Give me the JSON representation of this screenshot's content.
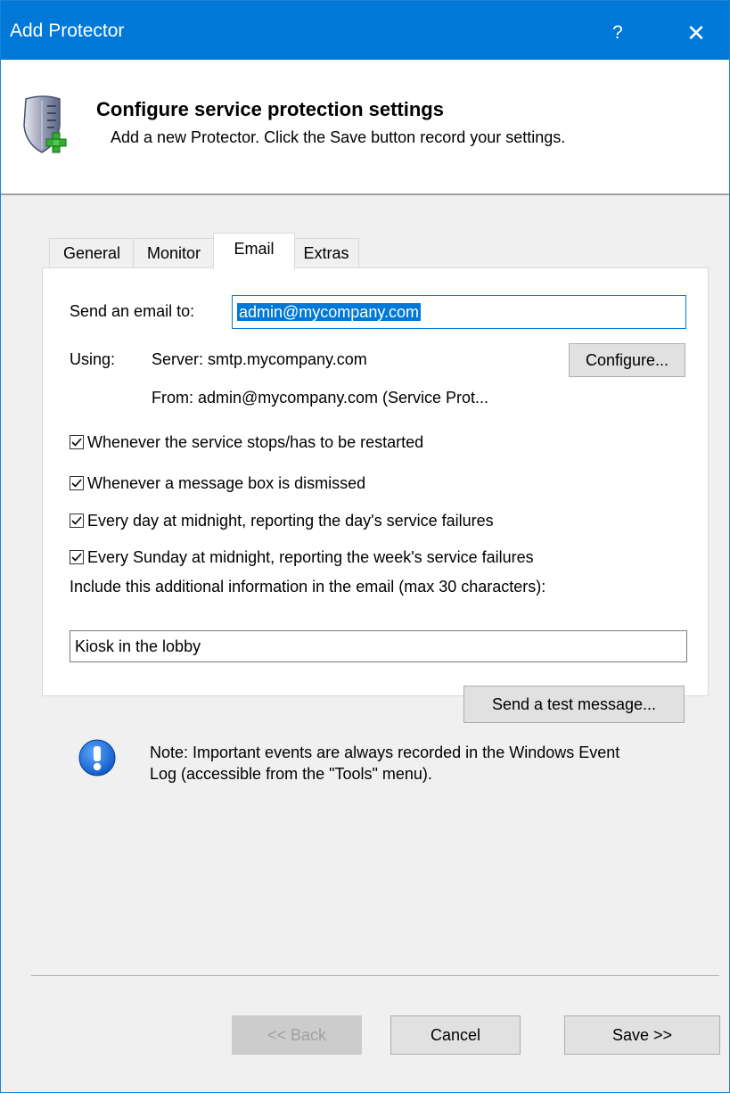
{
  "window": {
    "title": "Add Protector",
    "help_label": "?",
    "close_label": "✕"
  },
  "header": {
    "title": "Configure service protection settings",
    "subtitle": "Add a new Protector. Click the Save button record your settings."
  },
  "tabs": [
    {
      "label": "General",
      "active": false
    },
    {
      "label": "Monitor",
      "active": false
    },
    {
      "label": "Email",
      "active": true
    },
    {
      "label": "Extras",
      "active": false
    }
  ],
  "email": {
    "send_to_label": "Send an email to:",
    "send_to_value": "admin@mycompany.com",
    "using_label": "Using:",
    "server_text": "Server: smtp.mycompany.com",
    "from_text": "From: admin@mycompany.com (Service Prot...",
    "configure_button": "Configure...",
    "checkboxes": [
      {
        "label": "Whenever the service stops/has to be restarted",
        "checked": true
      },
      {
        "label": "Whenever a message box is dismissed",
        "checked": true
      },
      {
        "label": "Every day at midnight, reporting the day's service failures",
        "checked": true
      },
      {
        "label": "Every Sunday at midnight, reporting the week's service failures",
        "checked": true
      }
    ],
    "additional_info_label": "Include this additional information in the email (max 30 characters):",
    "additional_info_value": "Kiosk in the lobby",
    "test_button": "Send a test message...",
    "note_text": "Note: Important events are always recorded in the Windows Event Log (accessible from the \"Tools\" menu)."
  },
  "footer": {
    "back_button": "<< Back",
    "cancel_button": "Cancel",
    "save_button": "Save >>"
  },
  "colors": {
    "titlebar": "#0078d7",
    "selection": "#0078d7"
  }
}
